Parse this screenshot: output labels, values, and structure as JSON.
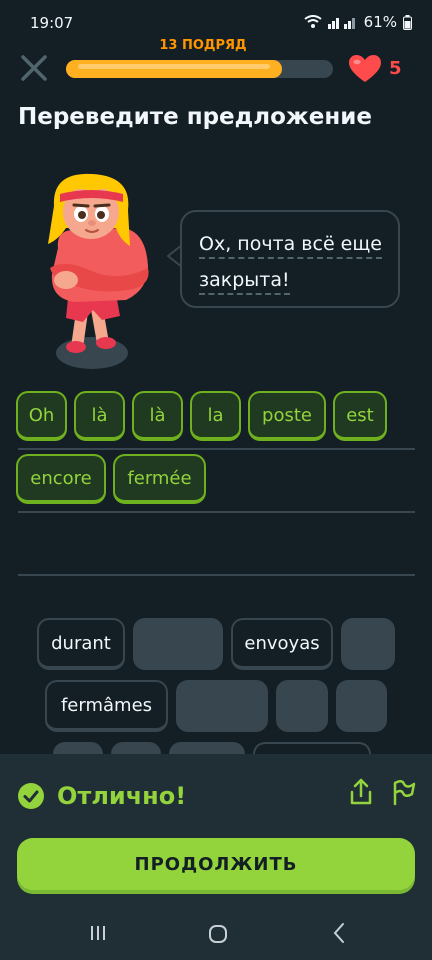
{
  "status_bar": {
    "time": "19:07",
    "icons": "wifi-icon signal-icon",
    "battery": "61%"
  },
  "header": {
    "streak_label": "13 ПОДРЯД",
    "progress": 0.81,
    "hearts": "5"
  },
  "prompt": {
    "title": "Переведите предложение",
    "source_lines": [
      "Ох, почта всё еще",
      "закрыта!"
    ]
  },
  "answer": {
    "row1": [
      "Oh",
      "là",
      "là",
      "la",
      "poste",
      "est"
    ],
    "row2": [
      "encore",
      "fermée"
    ]
  },
  "word_bank": {
    "row1": [
      "durant",
      "",
      "envoyas",
      ""
    ],
    "row2": [
      "fermâmes",
      "",
      "",
      ""
    ]
  },
  "feedback": {
    "message": "Отлично!",
    "continue_label": "ПРОДОЛЖИТЬ"
  },
  "colors": {
    "background": "#131f24",
    "accent_green": "#93d33c",
    "streak_orange": "#ff9600",
    "heart_red": "#ff4b4b"
  }
}
